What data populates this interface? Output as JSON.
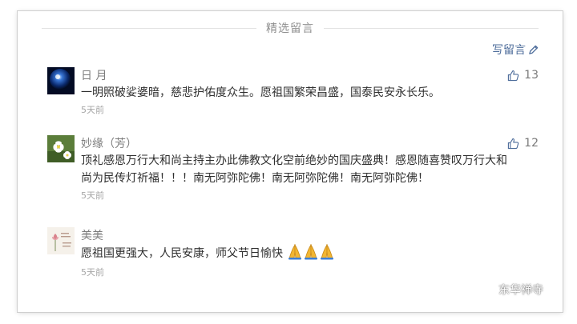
{
  "section": {
    "title": "精选留言"
  },
  "write_comment": {
    "label": "写留言",
    "icon": "pencil-icon"
  },
  "comments": [
    {
      "name": "日 月",
      "avatar_icon": "blue-sphere-avatar",
      "text": "一明照破娑婆暗，慈悲护佑度众生。愿祖国繁荣昌盛，国泰民安永长乐。",
      "time": "5天前",
      "likes": "13"
    },
    {
      "name": "妙缘（芳）",
      "avatar_icon": "white-flower-avatar",
      "text": "顶礼感恩万行大和尚主持主办此佛教文化空前绝妙的国庆盛典！感恩随喜赞叹万行大和尚为民传灯祈福！！！南无阿弥陀佛！南无阿弥陀佛！南无阿弥陀佛！",
      "time": "5天前",
      "likes": "12"
    },
    {
      "name": "美美",
      "avatar_icon": "lotus-painting-avatar",
      "text": "愿祖国更强大，人民安康，师父节日愉快",
      "time": "5天前"
    }
  ],
  "watermark": {
    "text": "东华禅寺",
    "icon": "wechat-icon"
  },
  "colors": {
    "link": "#4e6d9b",
    "name": "#7d7d7d",
    "text": "#2f2f2f",
    "time": "#a6a6a6",
    "divider": "#e3e3e3"
  }
}
